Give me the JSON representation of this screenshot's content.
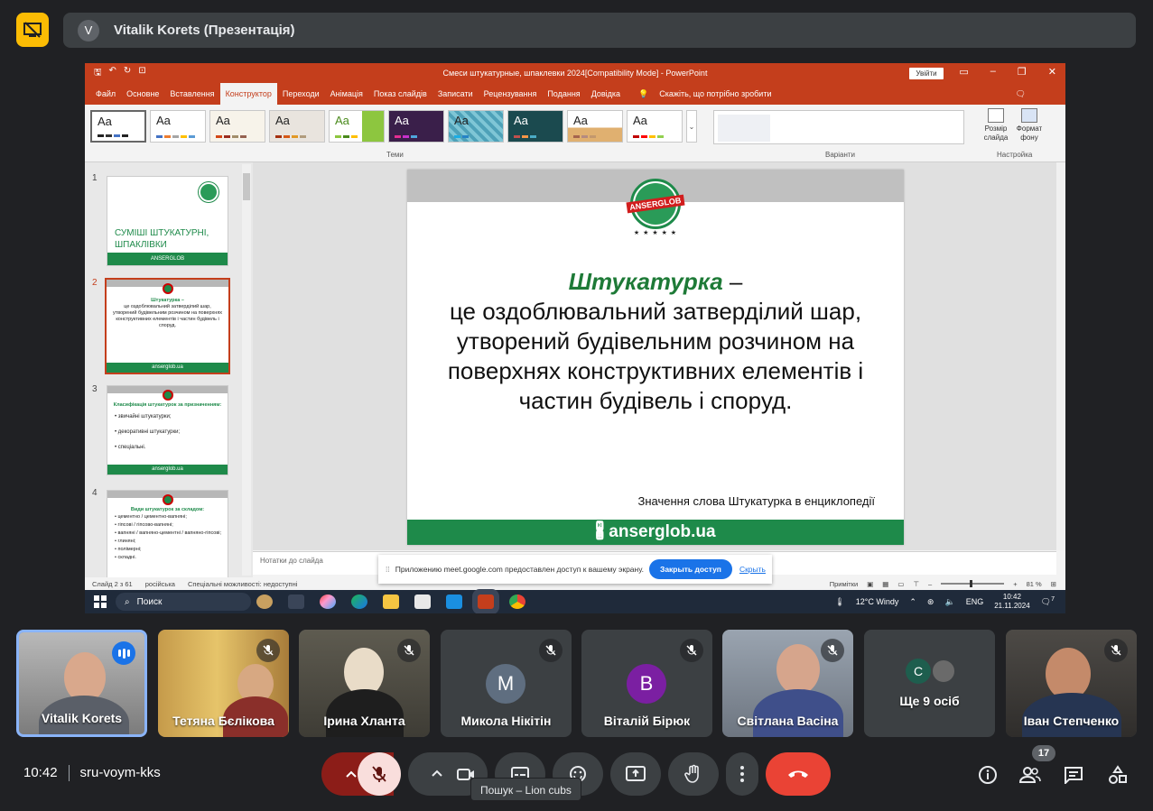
{
  "header": {
    "avatar_letter": "V",
    "title": "Vitalik Korets (Презентація)"
  },
  "ppt": {
    "doc_title": "Смеси штукатурные, шпаклевки 2024[Compatibility Mode] - PowerPoint",
    "login_label": "Увійти",
    "menu": [
      "Файл",
      "Основне",
      "Вставлення",
      "Конструктор",
      "Переходи",
      "Анімація",
      "Показ слайдів",
      "Записати",
      "Рецензування",
      "Подання",
      "Довідка"
    ],
    "active_menu": "Конструктор",
    "tell_me": "Скажіть, що потрібно зробити",
    "ribbon": {
      "theme_sample": "Aa",
      "themes_label": "Теми",
      "variants_label": "Варіанти",
      "customize_label": "Настройка",
      "slide_size": "Розмір слайда",
      "format_bg": "Формат фону"
    },
    "thumbnails": [
      {
        "num": "1",
        "title": "СУМІШІ ШТУКАТУРНІ, ШПАКЛІВКИ",
        "footer": "ANSERGLOB"
      },
      {
        "num": "2",
        "title": "Штукатурка –",
        "text": "це оздоблювальний затверділий шар, утворений будівельним розчином на поверхнях конструктивних елементів і частин будівель і споруд.",
        "footer": "anserglob.ua"
      },
      {
        "num": "3",
        "title": "Класифікація штукатурок за призначенням:",
        "bullets": [
          "звичайні штукатурки;",
          "декоративні штукатурки;",
          "спеціальні."
        ],
        "footer": "anserglob.ua"
      },
      {
        "num": "4",
        "title": "Види штукатурок за складом:",
        "bullets": [
          "цементно / цементно-вапняні;",
          "гіпсові / гіпсово-вапняні;",
          "вапняні / вапняно-цементні / вапняно-гіпсові;",
          "глиняні;",
          "полімерні;",
          "складні."
        ]
      }
    ],
    "slide": {
      "logo_text": "ANSERGLOB",
      "stars": "★ ★ ★ ★ ★",
      "term": "Штукатурка",
      "dash": " –",
      "line1": "це оздоблювальний затверділий шар,",
      "line2": "утворений будівельним розчином на",
      "line3": "поверхнях конструктивних елементів і",
      "line4": "частин будівель і споруд.",
      "note": "Значення слова Штукатурка в енциклопедії",
      "footer": "anserglob.ua"
    },
    "notes_placeholder": "Нотатки до слайда",
    "status": {
      "slide": "Слайд 2 з 61",
      "lang": "російська",
      "access": "Спеціальні можливості: недоступні",
      "comments": "Примітки",
      "zoom": "81 %"
    },
    "share_banner": {
      "text": "Приложению meet.google.com предоставлен доступ к вашему экрану.",
      "stop": "Закрыть доступ",
      "hide": "Скрыть"
    },
    "taskbar": {
      "search": "Поиск",
      "weather": "12°C  Windy",
      "lang": "ENG",
      "time": "10:42",
      "date": "21.11.2024",
      "notif": "7"
    }
  },
  "participants": [
    {
      "name": "Vitalik Korets",
      "speaking": true
    },
    {
      "name": "Тетяна Бєлікова"
    },
    {
      "name": "Ірина Хланта"
    },
    {
      "name": "Микола Нікітін",
      "initial": "M",
      "color": "#5f6e80"
    },
    {
      "name": "Віталій Бірюк",
      "initial": "B",
      "color": "#7b1fa2"
    },
    {
      "name": "Світлана Васіна"
    },
    {
      "name": "Ще 9 осіб",
      "initial": "C",
      "color": "#1e5e4e"
    },
    {
      "name": "Іван Степченко"
    }
  ],
  "meeting": {
    "time": "10:42",
    "code": "sru-voym-kks",
    "tooltip": "Пошук – Lion cubs",
    "people_count": "17"
  },
  "colors": {
    "ppt_accent": "#c43e1c",
    "brand_green": "#1e8a4a",
    "end_call": "#ea4335",
    "present_badge": "#fbbc04"
  }
}
